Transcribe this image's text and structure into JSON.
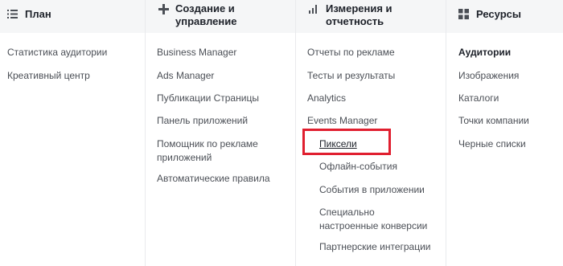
{
  "columns": {
    "plan": {
      "title": "План",
      "icon": "list-icon",
      "items": [
        "Статистика аудитории",
        "Креативный центр"
      ]
    },
    "create": {
      "title": "Создание и управление",
      "icon": "plus-icon",
      "items": [
        "Business Manager",
        "Ads Manager",
        "Публикации Страницы",
        "Панель приложений",
        "Помощник по рекламе приложений",
        "Автоматические правила"
      ]
    },
    "measure": {
      "title": "Измерения и отчетность",
      "icon": "bar-chart-icon",
      "items": [
        "Отчеты по рекламе",
        "Тесты и результаты",
        "Analytics",
        "Events Manager"
      ],
      "subitems": [
        "Пиксели",
        "Офлайн-события",
        "События в приложении",
        "Специально настроенные конверсии",
        "Партнерские интеграции"
      ]
    },
    "resources": {
      "title": "Ресурсы",
      "icon": "grid-icon",
      "items": [
        "Аудитории",
        "Изображения",
        "Каталоги",
        "Точки компании",
        "Черные списки"
      ]
    }
  },
  "colors": {
    "header_bg": "#f5f6f7",
    "highlight": "#e01f2f",
    "text": "#4b4f56",
    "title": "#1d2129"
  }
}
